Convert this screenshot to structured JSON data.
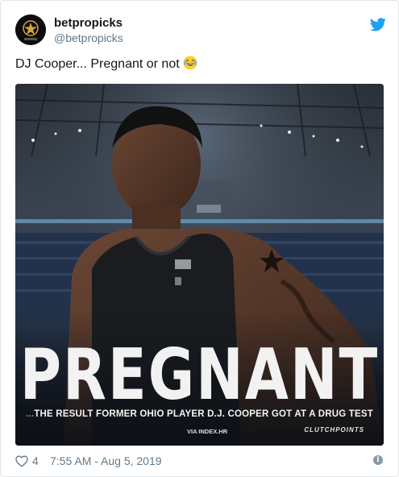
{
  "user": {
    "display_name": "betpropicks",
    "handle": "@betpropicks"
  },
  "tweet": {
    "text": "DJ Cooper... Pregnant or not",
    "emoji": "face-with-tears-of-joy"
  },
  "media": {
    "headline": "PREGNANT",
    "subline_dots": "...",
    "subline": "THE RESULT FORMER OHIO PLAYER D.J. COOPER GOT AT A DRUG TEST",
    "via": "VIA INDEX.HR",
    "watermark": "CLUTCHPOINTS"
  },
  "footer": {
    "likes": "4",
    "timestamp": "7:55 AM - Aug 5, 2019",
    "info_symbol": "i"
  },
  "colors": {
    "twitter_blue": "#1da1f2",
    "secondary_text": "#657786",
    "accent_orange": "#e8722a"
  }
}
